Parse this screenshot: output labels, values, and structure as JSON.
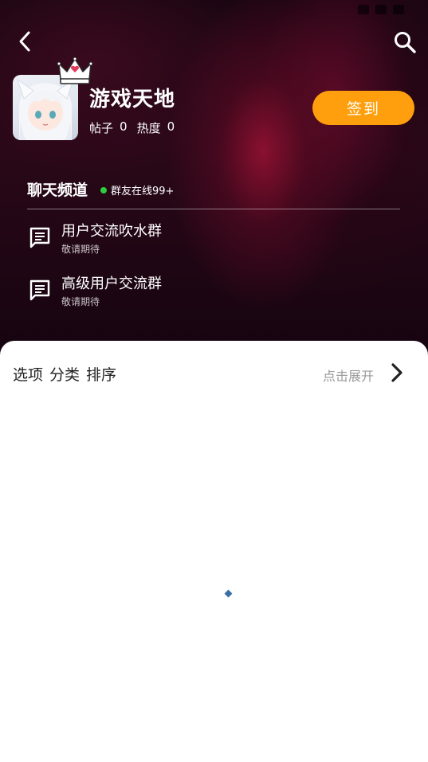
{
  "header": {
    "back_icon": "chevron-left-icon",
    "search_icon": "search-icon"
  },
  "group": {
    "title": "游戏天地",
    "posts_label": "帖子",
    "posts_count": "0",
    "heat_label": "热度",
    "heat_count": "0",
    "checkin_label": "签到",
    "checkin_color": "#ff9f0d"
  },
  "channels": {
    "title": "聊天频道",
    "online_text": "群友在线99+",
    "online_color": "#2ecc40",
    "items": [
      {
        "name": "用户交流吹水群",
        "subtitle": "敬请期待",
        "icon": "chat-icon"
      },
      {
        "name": "高级用户交流群",
        "subtitle": "敬请期待",
        "icon": "chat-icon"
      }
    ]
  },
  "filter": {
    "option1": "选项",
    "option2": "分类",
    "option3": "排序",
    "expand_text": "点击展开",
    "expand_icon": "chevron-right-icon"
  }
}
